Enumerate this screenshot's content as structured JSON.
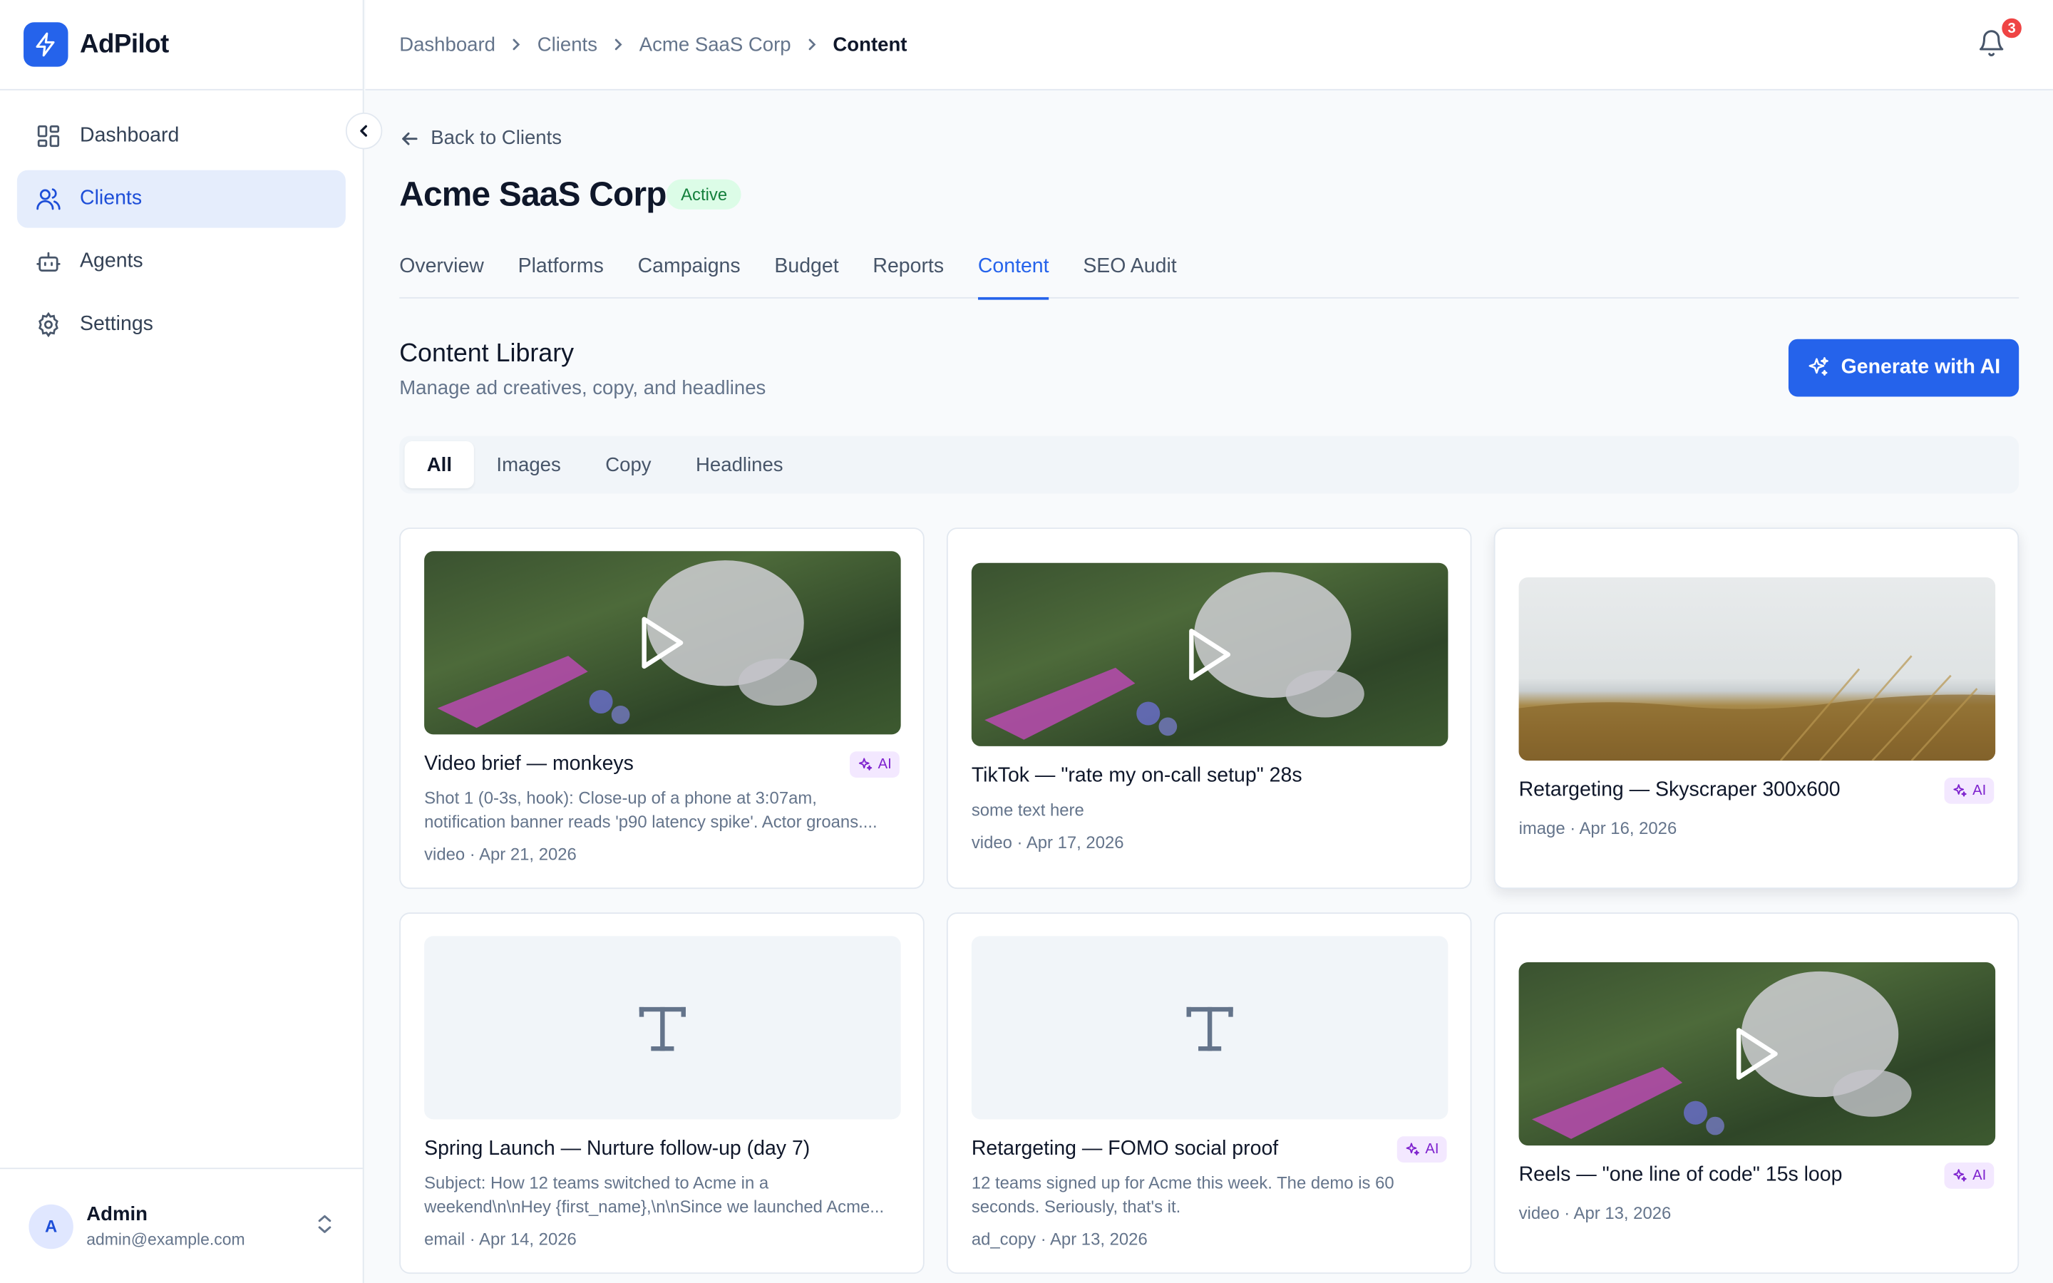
{
  "app": {
    "name": "AdPilot"
  },
  "sidebar": {
    "items": [
      {
        "label": "Dashboard",
        "icon": "dashboard-icon"
      },
      {
        "label": "Clients",
        "icon": "users-icon",
        "active": true
      },
      {
        "label": "Agents",
        "icon": "bot-icon"
      },
      {
        "label": "Settings",
        "icon": "gear-icon"
      }
    ],
    "user": {
      "initial": "A",
      "name": "Admin",
      "email": "admin@example.com"
    }
  },
  "breadcrumb": [
    "Dashboard",
    "Clients",
    "Acme SaaS Corp",
    "Content"
  ],
  "notifications": {
    "count": "3"
  },
  "client": {
    "back_label": "Back to Clients",
    "name": "Acme SaaS Corp",
    "status": "Active"
  },
  "tabs": [
    "Overview",
    "Platforms",
    "Campaigns",
    "Budget",
    "Reports",
    "Content",
    "SEO Audit"
  ],
  "active_tab": "Content",
  "content_library": {
    "title": "Content Library",
    "subtitle": "Manage ad creatives, copy, and headlines",
    "generate_label": "Generate with AI",
    "filters": [
      "All",
      "Images",
      "Copy",
      "Headlines"
    ],
    "active_filter": "All",
    "ai_label": "AI",
    "items": [
      {
        "title": "Video brief — monkeys",
        "desc": "Shot 1 (0-3s, hook): Close-up of a phone at 3:07am, notification banner reads 'p90 latency spike'. Actor groans....",
        "meta": "video · Apr 21, 2026",
        "ai": true,
        "kind": "video"
      },
      {
        "title": "TikTok — \"rate my on-call setup\" 28s",
        "desc": "some text here",
        "meta": "video · Apr 17, 2026",
        "ai": false,
        "kind": "video"
      },
      {
        "title": "Retargeting — Skyscraper 300x600",
        "desc": "",
        "meta": "image · Apr 16, 2026",
        "ai": true,
        "kind": "image"
      },
      {
        "title": "Spring Launch — Nurture follow-up (day 7)",
        "desc": "Subject: How 12 teams switched to Acme in a weekend\\n\\nHey {first_name},\\n\\nSince we launched Acme...",
        "meta": "email · Apr 14, 2026",
        "ai": false,
        "kind": "text"
      },
      {
        "title": "Retargeting — FOMO social proof",
        "desc": "12 teams signed up for Acme this week. The demo is 60 seconds. Seriously, that's it.",
        "meta": "ad_copy · Apr 13, 2026",
        "ai": true,
        "kind": "text"
      },
      {
        "title": "Reels — \"one line of code\" 15s loop",
        "desc": "",
        "meta": "video · Apr 13, 2026",
        "ai": true,
        "kind": "video"
      }
    ]
  },
  "colors": {
    "accent": "#2563eb",
    "active_badge": "#15803d",
    "ai_badge": "#7e22ce",
    "notification": "#ef4444"
  }
}
